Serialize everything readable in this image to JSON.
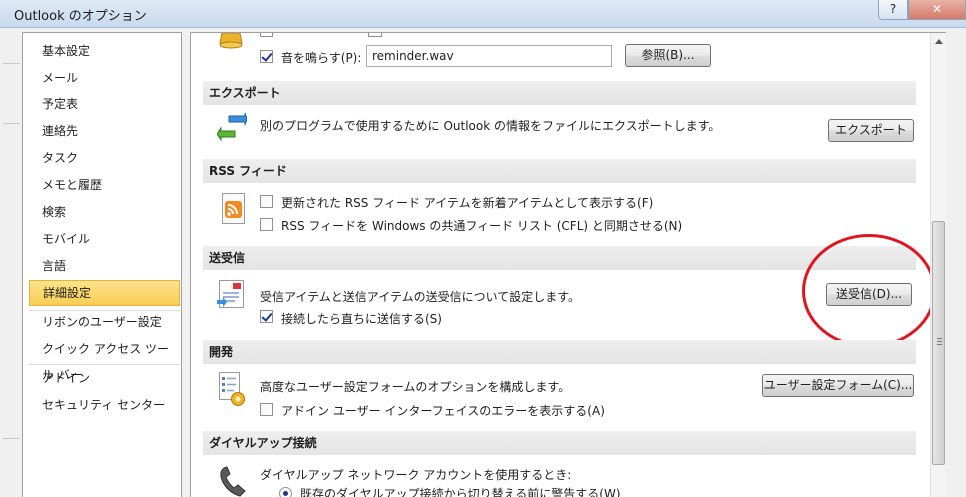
{
  "window": {
    "title": "Outlook のオプション",
    "help_label": "?",
    "close_label": "✕"
  },
  "nav": {
    "items": [
      {
        "label": "基本設定"
      },
      {
        "label": "メール"
      },
      {
        "label": "予定表"
      },
      {
        "label": "連絡先"
      },
      {
        "label": "タスク"
      },
      {
        "label": "メモと履歴"
      },
      {
        "label": "検索"
      },
      {
        "label": "モバイル"
      },
      {
        "label": "言語"
      },
      {
        "label": "詳細設定",
        "selected": true
      },
      {
        "label": "リボンのユーザー設定"
      },
      {
        "label": "クイック アクセス ツール バー"
      },
      {
        "label": "アドイン"
      },
      {
        "label": "セキュリティ センター"
      }
    ]
  },
  "reminder": {
    "sound_label": "音を鳴らす(P):",
    "sound_checked": true,
    "sound_file": "reminder.wav",
    "browse_label": "参照(B)..."
  },
  "export": {
    "header": "エクスポート",
    "description": "別のプログラムで使用するために Outlook の情報をファイルにエクスポートします。",
    "button_label": "エクスポート"
  },
  "rss": {
    "header": "RSS フィード",
    "option1": "更新された RSS フィード アイテムを新着アイテムとして表示する(F)",
    "option1_checked": false,
    "option2": "RSS フィードを Windows の共通フィード リスト (CFL) と同期させる(N)",
    "option2_checked": false
  },
  "send_receive": {
    "header": "送受信",
    "description": "受信アイテムと送信アイテムの送受信について設定します。",
    "button_label": "送受信(D)...",
    "send_immediately": "接続したら直ちに送信する(S)",
    "send_immediately_checked": true
  },
  "developer": {
    "header": "開発",
    "description": "高度なユーザー設定フォームのオプションを構成します。",
    "button_label": "ユーザー設定フォーム(C)...",
    "addin_errors": "アドイン ユーザー インターフェイスのエラーを表示する(A)",
    "addin_errors_checked": false
  },
  "dialup": {
    "header": "ダイヤルアップ接続",
    "description": "ダイヤルアップ ネットワーク アカウントを使用するとき:",
    "radio1": "既存のダイヤルアップ接続から切り替える前に警告する(W)",
    "radio1_selected": true
  },
  "colors": {
    "selected_nav": "#f8cd52",
    "callout": "#e0141e",
    "section_header": "#e8e8e8"
  }
}
